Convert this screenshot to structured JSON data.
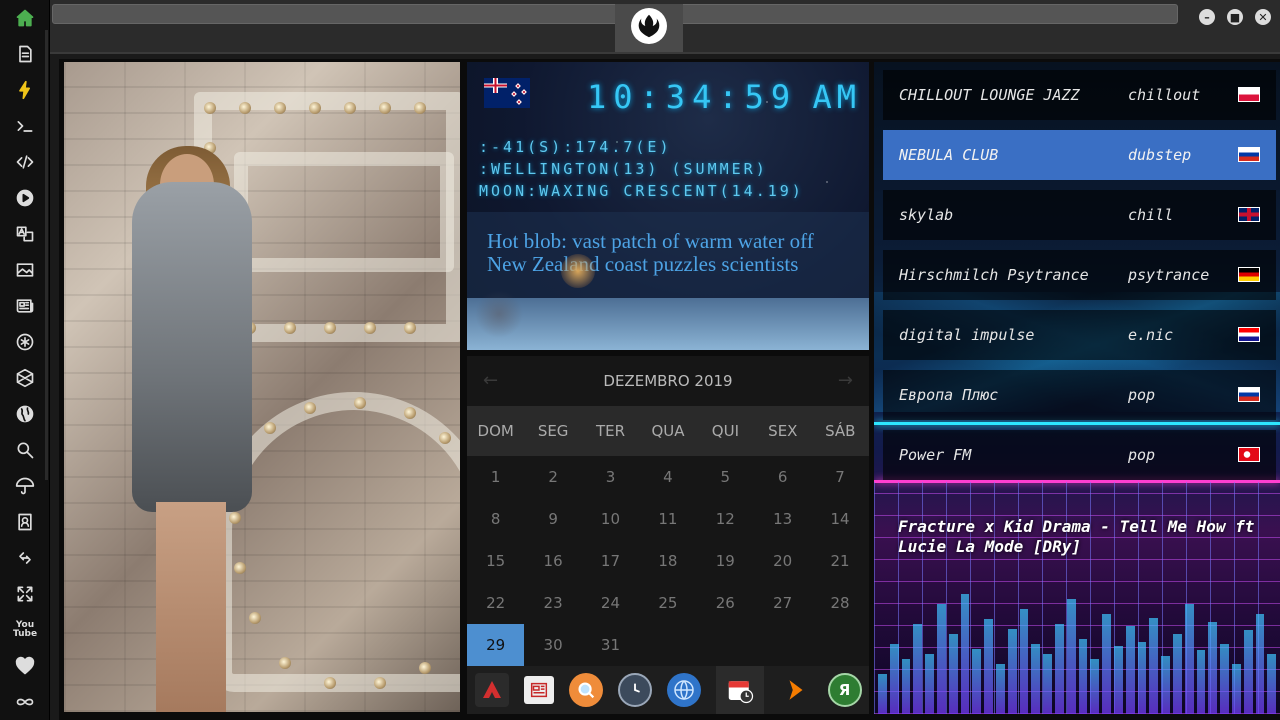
{
  "sidebar": {
    "items": [
      {
        "icon": "home-icon",
        "color": "#4caf50"
      },
      {
        "icon": "document-icon"
      },
      {
        "icon": "lightning-icon",
        "color": "#f0c419"
      },
      {
        "icon": "terminal-icon"
      },
      {
        "icon": "code-icon"
      },
      {
        "icon": "play-icon"
      },
      {
        "icon": "translate-icon"
      },
      {
        "icon": "image-icon"
      },
      {
        "icon": "newspaper-icon"
      },
      {
        "icon": "asterisk-icon"
      },
      {
        "icon": "hexagon-icon"
      },
      {
        "icon": "globe-icon"
      },
      {
        "icon": "search-icon"
      },
      {
        "icon": "umbrella-icon"
      },
      {
        "icon": "contact-card-icon"
      },
      {
        "icon": "link-icon"
      },
      {
        "icon": "expand-icon"
      },
      {
        "icon": "youtube-icon",
        "label": "You Tube"
      },
      {
        "icon": "heart-icon"
      },
      {
        "icon": "infinity-icon"
      }
    ]
  },
  "window": {
    "logo": "rebel-alliance-icon",
    "controls": [
      "minimize-icon",
      "maximize-icon",
      "close-icon"
    ]
  },
  "clock": {
    "flag": "new-zealand-flag",
    "time": "10:34:59",
    "ampm": "AM",
    "coords": ":-41(S):174.7(E)",
    "location": ":WELLINGTON(13) (SUMMER)",
    "moon": "MOON:WAXING CRESCENT(14.19)",
    "headline": "Hot blob: vast patch of warm water off New Zealand coast puzzles scientists",
    "accent": "#36c7f5"
  },
  "calendar": {
    "month_label": "DEZEMBRO 2019",
    "prev": "←",
    "next": "→",
    "weekdays": [
      "DOM",
      "SEG",
      "TER",
      "QUA",
      "QUI",
      "SEX",
      "SÁB"
    ],
    "weeks": [
      [
        "1",
        "2",
        "3",
        "4",
        "5",
        "6",
        "7"
      ],
      [
        "8",
        "9",
        "10",
        "11",
        "12",
        "13",
        "14"
      ],
      [
        "15",
        "16",
        "17",
        "18",
        "19",
        "20",
        "21"
      ],
      [
        "22",
        "23",
        "24",
        "25",
        "26",
        "27",
        "28"
      ],
      [
        "29",
        "30",
        "31",
        "",
        "",
        "",
        ""
      ]
    ],
    "today": "29",
    "today_color": "#4d8fd0"
  },
  "dock": {
    "items": [
      {
        "icon": "app-launcher-icon",
        "color": "#c62828"
      },
      {
        "icon": "news-icon",
        "color": "#eeeeee"
      },
      {
        "icon": "search-icon",
        "color": "#ef8c3a"
      },
      {
        "icon": "clock-icon",
        "color": "#3c4a5c"
      },
      {
        "icon": "globe-icon",
        "color": "#2f74c9"
      },
      {
        "icon": "calendar-icon",
        "color": "#e53935",
        "selected": true
      },
      {
        "icon": "play-arrow-icon",
        "color": "#f57c00"
      },
      {
        "icon": "yandex-icon",
        "label": "Я",
        "color": "#2e7d32"
      }
    ]
  },
  "radio": {
    "stations": [
      {
        "name": "CHILLOUT LOUNGE JAZZ",
        "genre": "chillout",
        "flag": "poland-flag"
      },
      {
        "name": "NEBULA CLUB",
        "genre": "dubstep",
        "flag": "russia-flag",
        "active": true
      },
      {
        "name": "skylab",
        "genre": "chill",
        "flag": "uk-flag"
      },
      {
        "name": "Hirschmilch Psytrance",
        "genre": "psytrance",
        "flag": "germany-flag"
      },
      {
        "name": "digital impulse",
        "genre": "e.nic",
        "flag": "croatia-flag"
      },
      {
        "name": "Европа Плюс",
        "genre": "pop",
        "flag": "russia-flag"
      },
      {
        "name": "Power FM",
        "genre": "pop",
        "flag": "turkey-flag"
      }
    ],
    "now_playing": "Fracture x Kid Drama - Tell Me How ft Lucie La Mode [DRy]",
    "active_color": "#3a6fc4"
  }
}
